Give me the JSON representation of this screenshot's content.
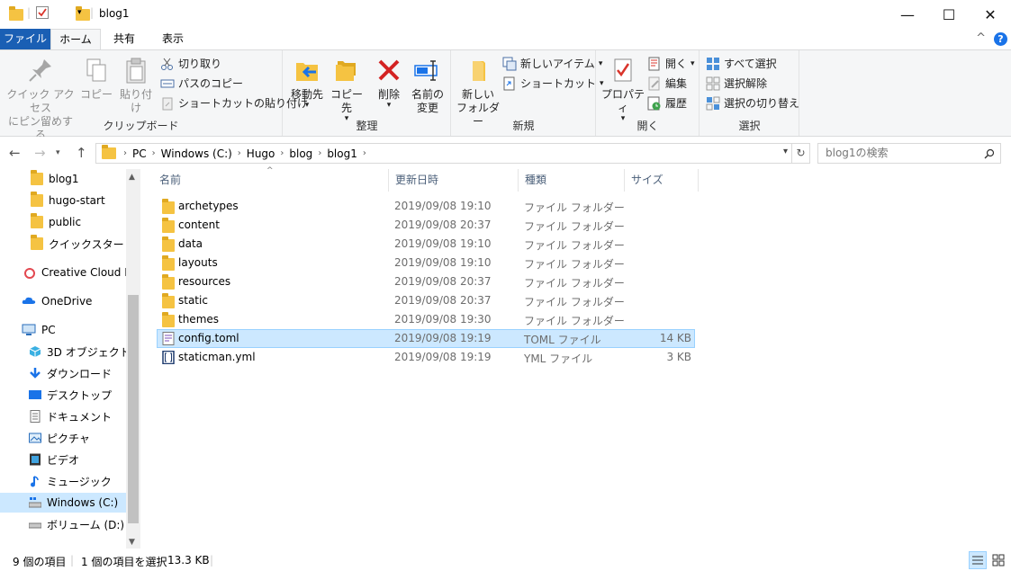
{
  "window": {
    "title": "blog1",
    "minimize": "—",
    "maximize": "☐",
    "close": "✕"
  },
  "tabs": {
    "file": "ファイル",
    "home": "ホーム",
    "share": "共有",
    "view": "表示",
    "collapse": "^",
    "help": "?"
  },
  "ribbon": {
    "clipboard": {
      "label": "クリップボード",
      "pin_line1": "クイック アクセス",
      "pin_line2": "にピン留めする",
      "copy": "コピー",
      "paste": "貼り付け",
      "cut": "切り取り",
      "copy_path": "パスのコピー",
      "paste_shortcut": "ショートカットの貼り付け"
    },
    "organize": {
      "label": "整理",
      "move_to": "移動先",
      "copy_to": "コピー先",
      "delete": "削除",
      "rename_line1": "名前の",
      "rename_line2": "変更"
    },
    "new": {
      "label": "新規",
      "new_folder_line1": "新しい",
      "new_folder_line2": "フォルダー",
      "new_item": "新しいアイテム",
      "shortcut": "ショートカット"
    },
    "open": {
      "label": "開く",
      "properties": "プロパティ",
      "open": "開く",
      "edit": "編集",
      "history": "履歴"
    },
    "select": {
      "label": "選択",
      "select_all": "すべて選択",
      "select_none": "選択解除",
      "invert": "選択の切り替え"
    }
  },
  "address": {
    "crumbs": [
      "PC",
      "Windows (C:)",
      "Hugo",
      "blog",
      "blog1"
    ],
    "search_placeholder": "blog1の検索"
  },
  "nav": {
    "items": [
      {
        "label": "blog1",
        "icon": "folder-icon"
      },
      {
        "label": "hugo-start",
        "icon": "folder-icon"
      },
      {
        "label": "public",
        "icon": "folder-icon"
      },
      {
        "label": "クイックスタート",
        "icon": "folder-icon"
      },
      {
        "label": "Creative Cloud Files",
        "icon": "creative-cloud-icon"
      },
      {
        "label": "OneDrive",
        "icon": "onedrive-icon"
      },
      {
        "label": "PC",
        "icon": "pc-icon"
      },
      {
        "label": "3D オブジェクト",
        "icon": "3d-objects-icon"
      },
      {
        "label": "ダウンロード",
        "icon": "download-icon"
      },
      {
        "label": "デスクトップ",
        "icon": "desktop-icon"
      },
      {
        "label": "ドキュメント",
        "icon": "documents-icon"
      },
      {
        "label": "ピクチャ",
        "icon": "pictures-icon"
      },
      {
        "label": "ビデオ",
        "icon": "videos-icon"
      },
      {
        "label": "ミュージック",
        "icon": "music-icon"
      },
      {
        "label": "Windows (C:)",
        "icon": "drive-icon"
      },
      {
        "label": "ボリューム (D:)",
        "icon": "drive-icon"
      }
    ]
  },
  "columns": {
    "name": "名前",
    "date": "更新日時",
    "type": "種類",
    "size": "サイズ"
  },
  "files": [
    {
      "name": "archetypes",
      "date": "2019/09/08 19:10",
      "type": "ファイル フォルダー",
      "size": ""
    },
    {
      "name": "content",
      "date": "2019/09/08 20:37",
      "type": "ファイル フォルダー",
      "size": ""
    },
    {
      "name": "data",
      "date": "2019/09/08 19:10",
      "type": "ファイル フォルダー",
      "size": ""
    },
    {
      "name": "layouts",
      "date": "2019/09/08 19:10",
      "type": "ファイル フォルダー",
      "size": ""
    },
    {
      "name": "resources",
      "date": "2019/09/08 20:37",
      "type": "ファイル フォルダー",
      "size": ""
    },
    {
      "name": "static",
      "date": "2019/09/08 20:37",
      "type": "ファイル フォルダー",
      "size": ""
    },
    {
      "name": "themes",
      "date": "2019/09/08 19:30",
      "type": "ファイル フォルダー",
      "size": ""
    },
    {
      "name": "config.toml",
      "date": "2019/09/08 19:19",
      "type": "TOML ファイル",
      "size": "14 KB"
    },
    {
      "name": "staticman.yml",
      "date": "2019/09/08 19:19",
      "type": "YML ファイル",
      "size": "3 KB"
    }
  ],
  "status": {
    "count": "9 個の項目",
    "selected": "1 個の項目を選択",
    "selected_size": "13.3 KB"
  }
}
